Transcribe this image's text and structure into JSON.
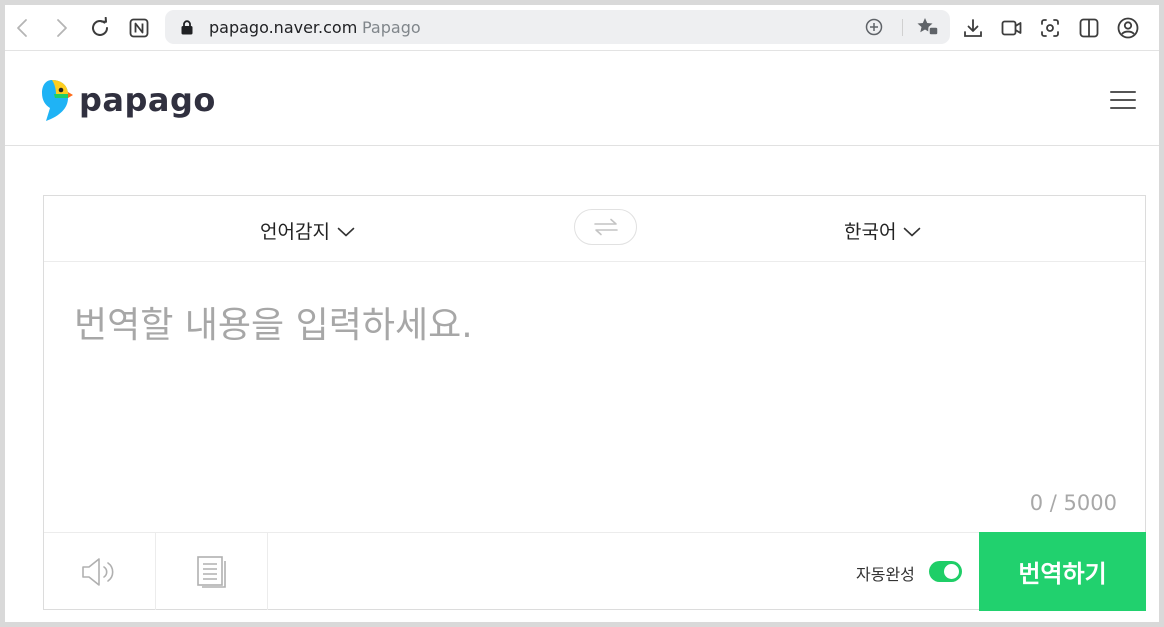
{
  "browser": {
    "url_host": "papago.naver.com",
    "page_title": "Papago"
  },
  "header": {
    "logo_text": "papago"
  },
  "translator": {
    "source_language": "언어감지",
    "target_language": "한국어",
    "input_value": "",
    "input_placeholder": "번역할 내용을 입력하세요.",
    "char_count": "0 / 5000",
    "auto_complete_label": "자동완성",
    "auto_complete_enabled": true,
    "translate_button_label": "번역하기"
  },
  "colors": {
    "brand_green": "#21d16e",
    "toggle_on": "#1fce67"
  }
}
